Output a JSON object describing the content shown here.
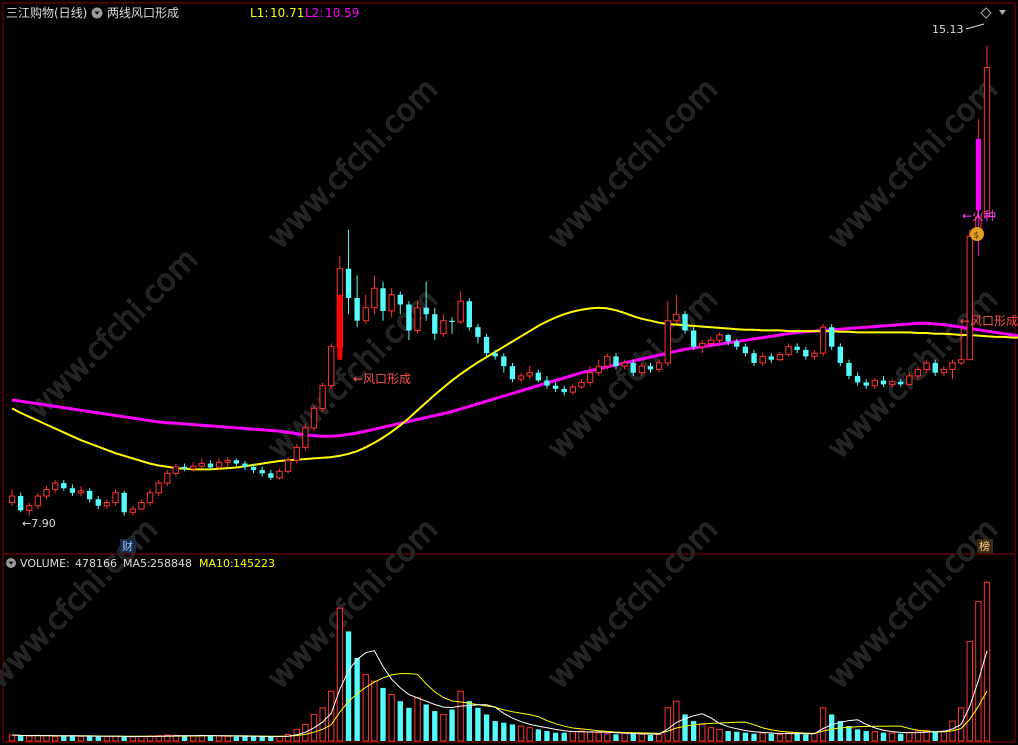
{
  "header": {
    "stock_name": "三江购物(日线)",
    "indicator_name": "两线风口形成",
    "l1_label": "L1:",
    "l1_value": "10.71",
    "l2_label": "L2:",
    "l2_value": "10.59"
  },
  "volume_header": {
    "label": "VOLUME:",
    "value": "478166",
    "ma5_label": "MA5:",
    "ma5_value": "258848",
    "ma10_label": "MA10:",
    "ma10_value": "145223"
  },
  "annotations": {
    "high_price": "15.13",
    "low_price": "←7.90",
    "fengkou_1": "←风口形成",
    "fengkou_2": "←风口形成",
    "huozhong": "←火种",
    "cai_badge": "财",
    "bang_badge": "榜"
  },
  "colors": {
    "up": "#ff3232",
    "down": "#54fcfc",
    "l1": "#ffff00",
    "l2": "#ff00ff",
    "text_red": "#ff5050",
    "grid": "#8b0000"
  },
  "chart_data": [
    {
      "type": "candlestick",
      "title": "三江购物(日线)",
      "ylim": [
        7.6,
        15.5
      ],
      "series": [
        {
          "name": "L1",
          "values": [
            9.55,
            9.48,
            9.42,
            9.36,
            9.3,
            9.24,
            9.18,
            9.12,
            9.06,
            9.01,
            8.96,
            8.91,
            8.86,
            8.82,
            8.78,
            8.74,
            8.7,
            8.67,
            8.65,
            8.63,
            8.62,
            8.61,
            8.61,
            8.61,
            8.62,
            8.63,
            8.64,
            8.66,
            8.68,
            8.7,
            8.72,
            8.74,
            8.75,
            8.76,
            8.77,
            8.78,
            8.79,
            8.8,
            8.82,
            8.85,
            8.89,
            8.95,
            9.02,
            9.1,
            9.19,
            9.29,
            9.4,
            9.52,
            9.64,
            9.76,
            9.87,
            9.98,
            10.08,
            10.17,
            10.26,
            10.34,
            10.42,
            10.5,
            10.58,
            10.66,
            10.74,
            10.82,
            10.89,
            10.95,
            11.0,
            11.04,
            11.07,
            11.09,
            11.1,
            11.09,
            11.06,
            11.02,
            10.97,
            10.93,
            10.9,
            10.87,
            10.85,
            10.84,
            10.83,
            10.82,
            10.81,
            10.8,
            10.79,
            10.78,
            10.77,
            10.76,
            10.76,
            10.75,
            10.75,
            10.75,
            10.74,
            10.74,
            10.74,
            10.74,
            10.74,
            10.74,
            10.73,
            10.73,
            10.72,
            10.72,
            10.72,
            10.72,
            10.72,
            10.72,
            10.72,
            10.71,
            10.71,
            10.7,
            10.7,
            10.69,
            10.68,
            10.68,
            10.67,
            10.66,
            10.65,
            10.65,
            10.64,
            10.64,
            10.64,
            10.64,
            10.65,
            10.66,
            10.68,
            10.71,
            10.75,
            10.82
          ]
        },
        {
          "name": "L2",
          "values": [
            9.68,
            9.66,
            9.64,
            9.62,
            9.6,
            9.58,
            9.56,
            9.54,
            9.52,
            9.5,
            9.48,
            9.46,
            9.44,
            9.42,
            9.4,
            9.38,
            9.36,
            9.34,
            9.33,
            9.32,
            9.31,
            9.3,
            9.29,
            9.28,
            9.27,
            9.26,
            9.25,
            9.24,
            9.23,
            9.22,
            9.21,
            9.2,
            9.18,
            9.16,
            9.14,
            9.13,
            9.12,
            9.12,
            9.13,
            9.15,
            9.17,
            9.2,
            9.23,
            9.26,
            9.29,
            9.32,
            9.35,
            9.38,
            9.41,
            9.44,
            9.47,
            9.5,
            9.54,
            9.58,
            9.62,
            9.66,
            9.7,
            9.74,
            9.78,
            9.82,
            9.86,
            9.9,
            9.94,
            9.98,
            10.02,
            10.06,
            10.1,
            10.13,
            10.16,
            10.19,
            10.22,
            10.25,
            10.28,
            10.31,
            10.34,
            10.37,
            10.4,
            10.43,
            10.46,
            10.48,
            10.5,
            10.52,
            10.54,
            10.56,
            10.58,
            10.6,
            10.62,
            10.64,
            10.66,
            10.68,
            10.7,
            10.72,
            10.73,
            10.74,
            10.75,
            10.76,
            10.77,
            10.78,
            10.79,
            10.8,
            10.81,
            10.82,
            10.83,
            10.84,
            10.85,
            10.86,
            10.86,
            10.85,
            10.84,
            10.82,
            10.8,
            10.78,
            10.76,
            10.74,
            10.72,
            10.7,
            10.68,
            10.66,
            10.65,
            10.64,
            10.63,
            10.62,
            10.61,
            10.6,
            10.59,
            10.59,
            10.63,
            10.72
          ]
        }
      ],
      "candles": [
        [
          8.1,
          8.2,
          8.3,
          8.05
        ],
        [
          8.2,
          7.98,
          8.25,
          7.95
        ],
        [
          7.98,
          8.05,
          8.1,
          7.9
        ],
        [
          8.05,
          8.2,
          8.25,
          8.0
        ],
        [
          8.2,
          8.3,
          8.35,
          8.15
        ],
        [
          8.3,
          8.4,
          8.45,
          8.25
        ],
        [
          8.4,
          8.32,
          8.45,
          8.28
        ],
        [
          8.32,
          8.25,
          8.38,
          8.2
        ],
        [
          8.25,
          8.28,
          8.35,
          8.2
        ],
        [
          8.28,
          8.15,
          8.32,
          8.1
        ],
        [
          8.15,
          8.05,
          8.2,
          8.0
        ],
        [
          8.05,
          8.1,
          8.15,
          8.0
        ],
        [
          8.1,
          8.25,
          8.3,
          8.05
        ],
        [
          8.25,
          7.95,
          8.28,
          7.9
        ],
        [
          7.95,
          8.0,
          8.05,
          7.9
        ],
        [
          8.0,
          8.1,
          8.15,
          7.98
        ],
        [
          8.1,
          8.25,
          8.3,
          8.05
        ],
        [
          8.25,
          8.4,
          8.45,
          8.2
        ],
        [
          8.4,
          8.55,
          8.6,
          8.35
        ],
        [
          8.55,
          8.65,
          8.7,
          8.5
        ],
        [
          8.65,
          8.62,
          8.7,
          8.58
        ],
        [
          8.62,
          8.66,
          8.72,
          8.58
        ],
        [
          8.66,
          8.7,
          8.78,
          8.62
        ],
        [
          8.7,
          8.64,
          8.75,
          8.6
        ],
        [
          8.64,
          8.72,
          8.78,
          8.6
        ],
        [
          8.72,
          8.75,
          8.8,
          8.65
        ],
        [
          8.75,
          8.7,
          8.78,
          8.66
        ],
        [
          8.7,
          8.65,
          8.74,
          8.6
        ],
        [
          8.65,
          8.6,
          8.7,
          8.55
        ],
        [
          8.6,
          8.55,
          8.65,
          8.5
        ],
        [
          8.55,
          8.48,
          8.6,
          8.45
        ],
        [
          8.48,
          8.58,
          8.62,
          8.45
        ],
        [
          8.58,
          8.75,
          8.8,
          8.55
        ],
        [
          8.75,
          8.95,
          9.0,
          8.7
        ],
        [
          8.95,
          9.25,
          9.3,
          8.9
        ],
        [
          9.25,
          9.55,
          9.6,
          9.2
        ],
        [
          9.55,
          9.9,
          9.95,
          9.5
        ],
        [
          9.9,
          10.5,
          10.55,
          9.85
        ],
        [
          10.5,
          11.7,
          11.9,
          10.4
        ],
        [
          11.7,
          11.25,
          12.3,
          11.0
        ],
        [
          11.25,
          10.9,
          11.6,
          10.8
        ],
        [
          10.9,
          11.1,
          11.3,
          10.85
        ],
        [
          11.1,
          11.4,
          11.6,
          11.0
        ],
        [
          11.4,
          11.05,
          11.5,
          10.9
        ],
        [
          11.05,
          11.3,
          11.4,
          10.95
        ],
        [
          11.3,
          11.15,
          11.35,
          11.0
        ],
        [
          11.15,
          10.75,
          11.2,
          10.6
        ],
        [
          10.75,
          11.1,
          11.2,
          10.7
        ],
        [
          11.1,
          11.0,
          11.5,
          10.9
        ],
        [
          11.0,
          10.7,
          11.1,
          10.6
        ],
        [
          10.7,
          10.9,
          11.0,
          10.65
        ],
        [
          10.9,
          10.88,
          10.95,
          10.7
        ],
        [
          10.88,
          11.2,
          11.35,
          10.85
        ],
        [
          11.2,
          10.8,
          11.25,
          10.75
        ],
        [
          10.8,
          10.65,
          10.85,
          10.55
        ],
        [
          10.65,
          10.4,
          10.7,
          10.35
        ],
        [
          10.4,
          10.35,
          10.45,
          10.3
        ],
        [
          10.35,
          10.2,
          10.4,
          10.1
        ],
        [
          10.2,
          10.0,
          10.25,
          9.95
        ],
        [
          10.0,
          10.05,
          10.1,
          9.95
        ],
        [
          10.05,
          10.1,
          10.2,
          10.0
        ],
        [
          10.1,
          9.98,
          10.15,
          9.95
        ],
        [
          9.98,
          9.9,
          10.05,
          9.85
        ],
        [
          9.9,
          9.85,
          9.95,
          9.8
        ],
        [
          9.85,
          9.8,
          9.9,
          9.75
        ],
        [
          9.8,
          9.88,
          9.92,
          9.76
        ],
        [
          9.88,
          9.95,
          10.0,
          9.85
        ],
        [
          9.95,
          10.1,
          10.2,
          9.9
        ],
        [
          10.1,
          10.2,
          10.3,
          10.05
        ],
        [
          10.2,
          10.35,
          10.4,
          10.15
        ],
        [
          10.35,
          10.2,
          10.4,
          10.15
        ],
        [
          10.2,
          10.25,
          10.3,
          10.15
        ],
        [
          10.25,
          10.1,
          10.3,
          10.05
        ],
        [
          10.1,
          10.2,
          10.25,
          10.05
        ],
        [
          10.2,
          10.15,
          10.25,
          10.1
        ],
        [
          10.15,
          10.25,
          10.3,
          10.1
        ],
        [
          10.25,
          10.9,
          11.2,
          10.2
        ],
        [
          10.9,
          11.0,
          11.3,
          10.85
        ],
        [
          11.0,
          10.75,
          11.05,
          10.7
        ],
        [
          10.75,
          10.5,
          10.8,
          10.45
        ],
        [
          10.5,
          10.55,
          10.6,
          10.4
        ],
        [
          10.55,
          10.6,
          10.65,
          10.5
        ],
        [
          10.6,
          10.68,
          10.72,
          10.55
        ],
        [
          10.68,
          10.58,
          10.7,
          10.52
        ],
        [
          10.58,
          10.5,
          10.62,
          10.45
        ],
        [
          10.5,
          10.4,
          10.55,
          10.35
        ],
        [
          10.4,
          10.25,
          10.45,
          10.2
        ],
        [
          10.25,
          10.35,
          10.4,
          10.2
        ],
        [
          10.35,
          10.3,
          10.4,
          10.25
        ],
        [
          10.3,
          10.38,
          10.42,
          10.28
        ],
        [
          10.38,
          10.5,
          10.55,
          10.35
        ],
        [
          10.5,
          10.45,
          10.55,
          10.4
        ],
        [
          10.45,
          10.35,
          10.5,
          10.3
        ],
        [
          10.35,
          10.4,
          10.45,
          10.3
        ],
        [
          10.4,
          10.8,
          10.85,
          10.35
        ],
        [
          10.8,
          10.5,
          10.85,
          10.45
        ],
        [
          10.5,
          10.25,
          10.55,
          10.2
        ],
        [
          10.25,
          10.05,
          10.3,
          10.0
        ],
        [
          10.05,
          9.95,
          10.1,
          9.9
        ],
        [
          9.95,
          9.9,
          10.0,
          9.85
        ],
        [
          9.9,
          9.98,
          10.02,
          9.85
        ],
        [
          9.98,
          9.92,
          10.05,
          9.88
        ],
        [
          9.92,
          9.96,
          10.0,
          9.88
        ],
        [
          9.96,
          9.92,
          10.0,
          9.88
        ],
        [
          9.92,
          10.05,
          10.1,
          9.9
        ],
        [
          10.05,
          10.15,
          10.2,
          10.0
        ],
        [
          10.15,
          10.25,
          10.3,
          10.1
        ],
        [
          10.25,
          10.1,
          10.3,
          10.05
        ],
        [
          10.1,
          10.15,
          10.2,
          10.05
        ],
        [
          10.15,
          10.25,
          10.3,
          10.0
        ],
        [
          10.25,
          10.3,
          10.8,
          10.22
        ],
        [
          10.3,
          12.2,
          12.3,
          10.3
        ],
        [
          12.2,
          12.5,
          14.0,
          12.1
        ],
        [
          12.5,
          14.8,
          15.13,
          12.45
        ]
      ],
      "ohlc_order": [
        "open",
        "close",
        "high",
        "low"
      ]
    },
    {
      "type": "bar",
      "title": "VOLUME",
      "ylim": [
        0,
        500000
      ],
      "values": [
        18000,
        16000,
        15000,
        17000,
        16000,
        14000,
        15000,
        16000,
        14000,
        15000,
        13000,
        14000,
        15000,
        12000,
        13000,
        14000,
        15000,
        16000,
        18000,
        17000,
        16000,
        15000,
        17000,
        16000,
        15000,
        14000,
        13000,
        15000,
        14000,
        13000,
        12000,
        14000,
        20000,
        35000,
        50000,
        80000,
        100000,
        150000,
        400000,
        330000,
        250000,
        200000,
        180000,
        160000,
        140000,
        120000,
        100000,
        130000,
        110000,
        90000,
        80000,
        95000,
        150000,
        120000,
        100000,
        80000,
        60000,
        55000,
        50000,
        45000,
        40000,
        35000,
        30000,
        25000,
        25000,
        28000,
        30000,
        28000,
        25000,
        22000,
        20000,
        24000,
        22000,
        20000,
        18000,
        20000,
        100000,
        120000,
        80000,
        60000,
        50000,
        40000,
        35000,
        30000,
        28000,
        25000,
        22000,
        24000,
        22000,
        20000,
        24000,
        22000,
        20000,
        22000,
        100000,
        80000,
        60000,
        45000,
        35000,
        30000,
        28000,
        25000,
        24000,
        22000,
        26000,
        30000,
        32000,
        28000,
        30000,
        60000,
        100000,
        300000,
        420000,
        478166
      ],
      "series": [
        {
          "name": "MA5"
        },
        {
          "name": "MA10"
        }
      ]
    }
  ]
}
